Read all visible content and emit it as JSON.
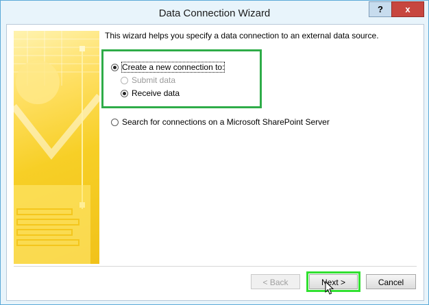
{
  "window": {
    "title": "Data Connection Wizard",
    "help_label": "?",
    "close_label": "x"
  },
  "intro_text": "This wizard helps you specify a data connection to an external data source.",
  "options": {
    "create_new": "Create a new connection to:",
    "submit_data": "Submit data",
    "receive_data": "Receive data",
    "search_sharepoint": "Search for connections on a Microsoft SharePoint Server"
  },
  "state": {
    "create_new_selected": true,
    "receive_data_selected": true,
    "submit_data_enabled": false
  },
  "buttons": {
    "back": "< Back",
    "next": "Next >",
    "cancel": "Cancel"
  },
  "colors": {
    "highlight_box": "#2eac48",
    "next_highlight": "#30e030",
    "close_button": "#c7463f"
  }
}
